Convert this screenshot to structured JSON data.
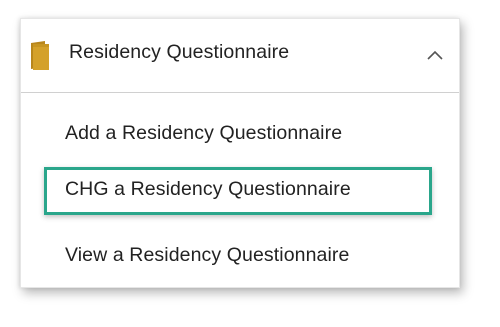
{
  "header": {
    "title": "Residency Questionnaire",
    "icon": "folder-icon",
    "toggle_icon": "chevron-up-icon",
    "expanded": true
  },
  "menu": {
    "items": [
      {
        "label": "Add a Residency Questionnaire"
      },
      {
        "label": "CHG a Residency Questionnaire",
        "highlighted": true
      },
      {
        "label": "View a Residency Questionnaire"
      }
    ]
  },
  "colors": {
    "highlight_border": "#2aa68b",
    "folder_front": "#d4a12a",
    "folder_back": "#b8861c",
    "text": "#222222"
  }
}
